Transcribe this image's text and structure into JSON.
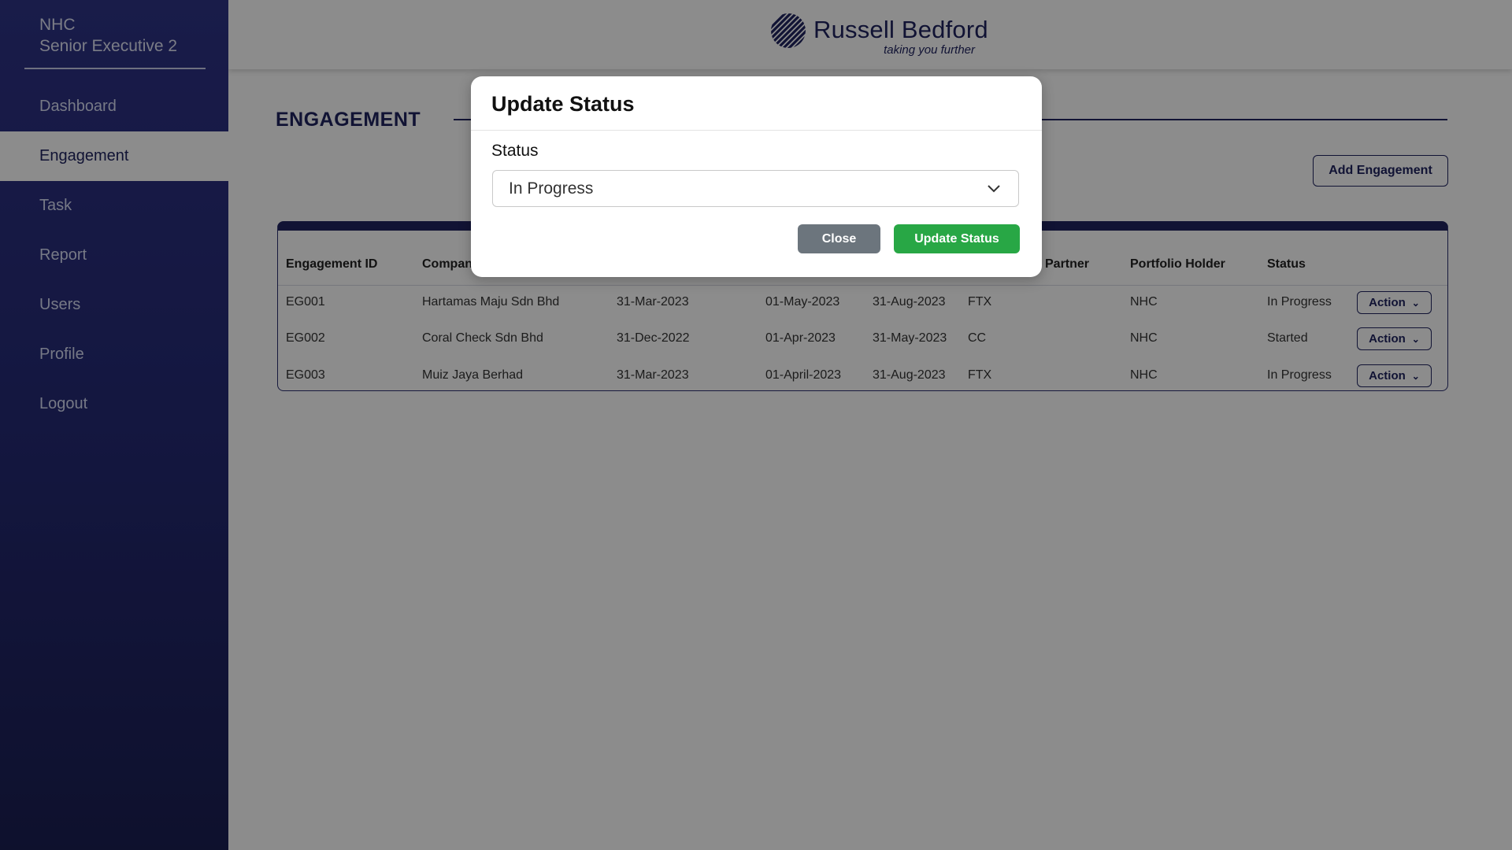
{
  "sidebar": {
    "user_line1": "NHC",
    "user_line2": "Senior Executive 2",
    "items": [
      {
        "label": "Dashboard"
      },
      {
        "label": "Engagement",
        "active": true
      },
      {
        "label": "Task"
      },
      {
        "label": "Report"
      },
      {
        "label": "Users"
      },
      {
        "label": "Profile"
      },
      {
        "label": "Logout"
      }
    ]
  },
  "header": {
    "logo_name": "Russell Bedford",
    "logo_tagline": "taking you further",
    "logo_icon": "striped-circle-logo-icon"
  },
  "main": {
    "title": "ENGAGEMENT",
    "add_button": "Add Engagement",
    "table": {
      "columns": [
        "Engagement ID",
        "Compan",
        "Partner",
        "Portfolio Holder",
        "Status"
      ],
      "rows": [
        {
          "id": "EG001",
          "company": "Hartamas Maju Sdn Bhd",
          "d1": "31-Mar-2023",
          "d2": "01-May-2023",
          "d3": "31-Aug-2023",
          "partner": "FTX",
          "holder": "NHC",
          "status": "In Progress",
          "action": "Action"
        },
        {
          "id": "EG002",
          "company": "Coral Check Sdn Bhd",
          "d1": "31-Dec-2022",
          "d2": "01-Apr-2023",
          "d3": "31-May-2023",
          "partner": "CC",
          "holder": "NHC",
          "status": "Started",
          "action": "Action"
        },
        {
          "id": "EG003",
          "company": "Muiz Jaya Berhad",
          "d1": "31-Mar-2023",
          "d2": "01-April-2023",
          "d3": "31-Aug-2023",
          "partner": "FTX",
          "holder": "NHC",
          "status": "In Progress",
          "action": "Action"
        }
      ]
    }
  },
  "modal": {
    "title": "Update Status",
    "field_label": "Status",
    "selected_value": "In Progress",
    "close_label": "Close",
    "update_label": "Update Status"
  },
  "colors": {
    "sidebar": "#252a75",
    "brand_navy": "#1f2460",
    "close_button": "#6c757d",
    "update_button": "#28a745"
  }
}
